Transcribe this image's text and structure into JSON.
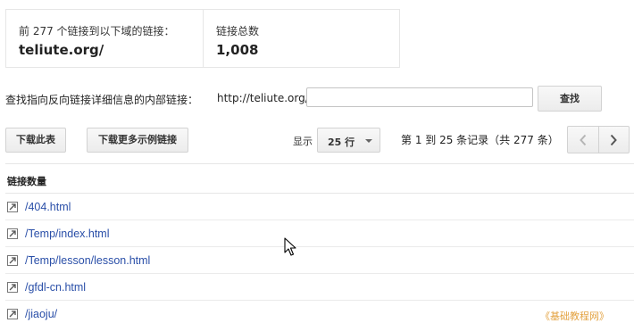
{
  "stats": {
    "top_links_label": "前 277 个链接到以下域的链接：",
    "domain": "teliute.org/",
    "total_label": "链接总数",
    "total_value": "1,008"
  },
  "search": {
    "label": "查找指向反向链接详细信息的内部链接：",
    "prefix": "http://teliute.org/",
    "value": "",
    "button_label": "查找"
  },
  "toolbar": {
    "download_table_label": "下载此表",
    "download_more_label": "下载更多示例链接",
    "show_label": "显示",
    "rows_selected": "25 行",
    "page_info": "第 1 到 25 条记录（共 277 条）"
  },
  "table": {
    "header": "链接数量",
    "rows": [
      {
        "link": "/404.html"
      },
      {
        "link": "/Temp/index.html"
      },
      {
        "link": "/Temp/lesson/lesson.html"
      },
      {
        "link": "/gfdl-cn.html"
      },
      {
        "link": "/jiaoju/"
      }
    ]
  },
  "watermark": "《基础教程网》",
  "icons": {
    "prev": "chevron-left-icon",
    "next": "chevron-right-icon",
    "external": "external-link-icon",
    "cursor": "mouse-pointer-icon"
  }
}
